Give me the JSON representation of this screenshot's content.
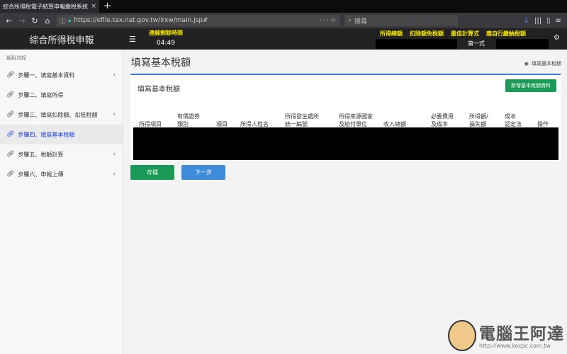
{
  "browser": {
    "tab_title": "綜合所得稅電子結算申報繳稅系統",
    "tab_close": "×",
    "new_tab": "+",
    "url": "https://efile.tax.nat.gov.tw/irxw/main.jsp#",
    "search_placeholder": "搜尋"
  },
  "header": {
    "brand": "綜合所得稅申報",
    "timer_label": "連線剩餘時間",
    "timer_value": "04:49",
    "links": [
      "所得總額",
      "扣除額免稅額",
      "最佳計算式",
      "應自行繳納稅額"
    ],
    "calc_style": "第一式"
  },
  "sidebar": {
    "title": "報稅流程",
    "items": [
      {
        "label": "步驟一、填寫基本資料",
        "chevron": "‹"
      },
      {
        "label": "步驟二、填寫所得",
        "chevron": ""
      },
      {
        "label": "步驟三、填寫扣除額、扣抵稅額",
        "chevron": "‹"
      },
      {
        "label": "步驟四、填寫基本稅額",
        "chevron": ""
      },
      {
        "label": "步驟五、稅額計算",
        "chevron": "‹"
      },
      {
        "label": "步驟六、申報上傳",
        "chevron": "‹"
      }
    ]
  },
  "main": {
    "page_title": "填寫基本稅額",
    "breadcrumb": "填寫基本稅額",
    "card_title": "填寫基本稅額",
    "add_button": "新增基本稅額資料",
    "columns": [
      [
        "所得項目"
      ],
      [
        "有價證券",
        "類別"
      ],
      [
        "項目"
      ],
      [
        "所得人姓名"
      ],
      [
        "所得發生處所",
        "統一編號"
      ],
      [
        "所得來源國家",
        "及給付單位"
      ],
      [
        "收入總額"
      ],
      [
        "必要費用",
        "及成本"
      ],
      [
        "所得額/",
        "損失額"
      ],
      [
        "成本",
        "認定法"
      ],
      [
        "操作"
      ]
    ],
    "save_button": "存檔",
    "next_button": "下一步"
  },
  "watermark": {
    "text": "電腦王阿達",
    "url": "http://www.kocpc.com.tw"
  },
  "colors": {
    "accent_yellow": "#f5e600",
    "save_green": "#1a9a56",
    "next_blue": "#3d8bd9",
    "card_top_border": "#3a7bd5",
    "active_nav": "#1a3fd1"
  }
}
